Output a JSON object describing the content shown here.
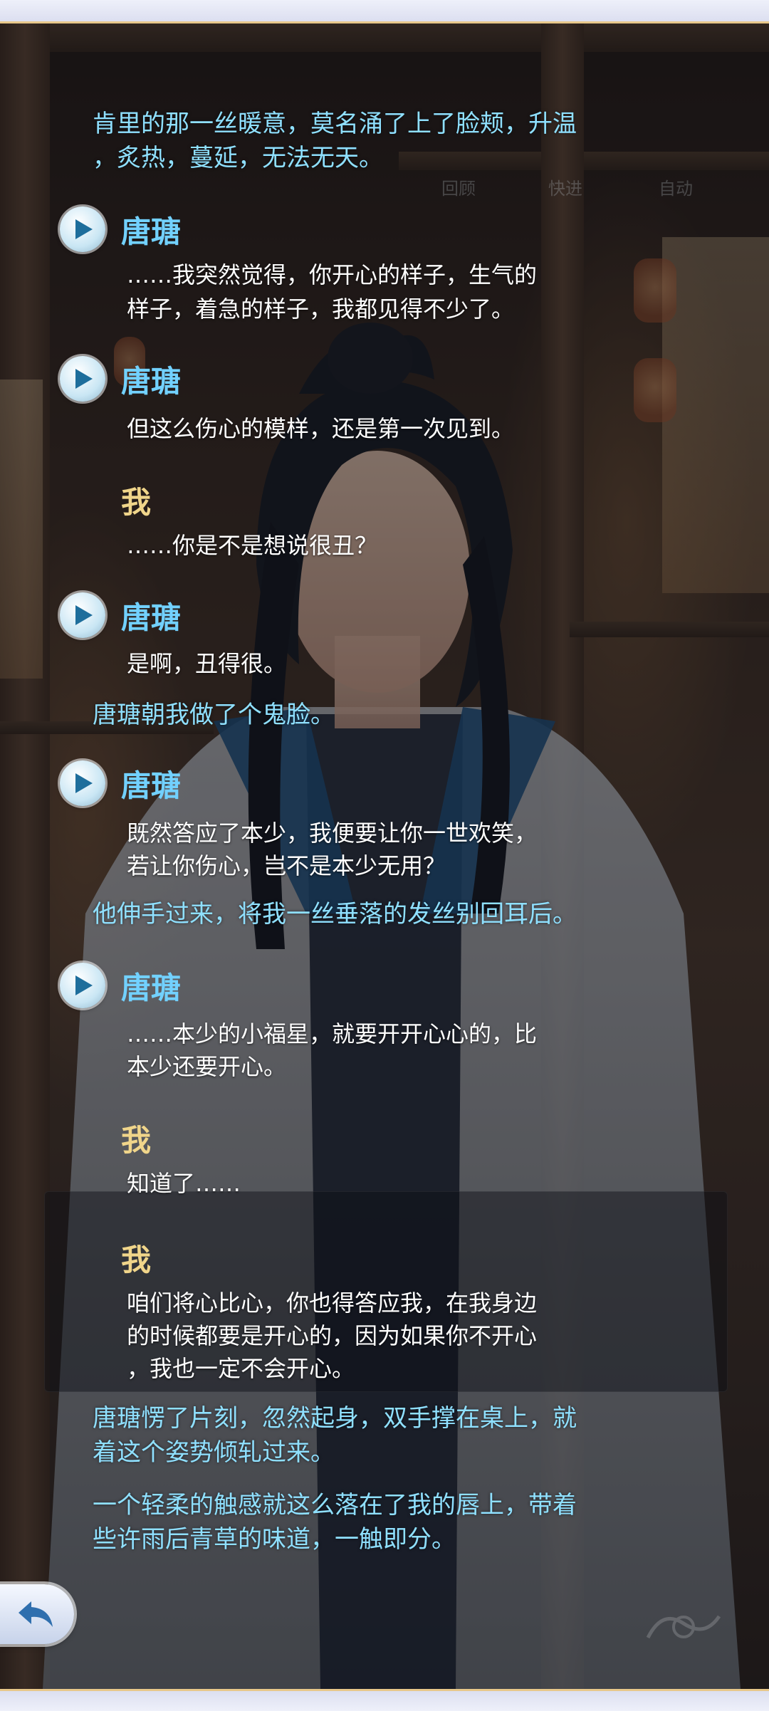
{
  "dialogue": {
    "top_narration": [
      "肯里的那一丝暖意，莫名涌了上了脸颊，升温",
      "，炙热，蔓延，无法无天。"
    ],
    "faded_toolbar": [
      "回顾",
      "快进",
      "自动"
    ],
    "entries": [
      {
        "speaker": "唐瑭",
        "lines": [
          "……我突然觉得，你开心的样子，生气的",
          "样子，着急的样子，我都见得不少了。"
        ]
      },
      {
        "speaker": "唐瑭",
        "lines": [
          "但这么伤心的模样，还是第一次见到。"
        ]
      },
      {
        "speaker": "我",
        "lines": [
          "……你是不是想说很丑？"
        ]
      },
      {
        "speaker": "唐瑭",
        "lines": [
          "是啊，丑得很。"
        ]
      },
      {
        "narration": "唐瑭朝我做了个鬼脸。"
      },
      {
        "speaker": "唐瑭",
        "lines": [
          "既然答应了本少，我便要让你一世欢笑，",
          "若让你伤心，岂不是本少无用？"
        ]
      },
      {
        "narration": "他伸手过来，将我一丝垂落的发丝别回耳后。"
      },
      {
        "speaker": "唐瑭",
        "lines": [
          "……本少的小福星，就要开开心心的，比",
          "本少还要开心。"
        ]
      },
      {
        "speaker": "我",
        "lines": [
          "知道了……"
        ]
      },
      {
        "speaker": "我",
        "lines": [
          "咱们将心比心，你也得答应我，在我身边",
          "的时候都要是开心的，因为如果你不开心",
          "，我也一定不会开心。"
        ]
      }
    ],
    "bottom_narration": [
      [
        "唐瑭愣了片刻，忽然起身，双手撑在桌上，就",
        "着这个姿势倾轧过来。"
      ],
      [
        "一个轻柔的触感就这么落在了我的唇上，带着",
        "些许雨后青草的味道，一触即分。"
      ]
    ]
  },
  "controls": {
    "back_icon": "return-arrow-icon",
    "voice_icon": "play-voice-icon"
  },
  "colors": {
    "narration": "#8fe0ff",
    "name_tangtang": "#72d1ff",
    "name_me": "#f0d58a",
    "dialogue_text": "#ffffff",
    "frame_border": "#e8c88a"
  }
}
